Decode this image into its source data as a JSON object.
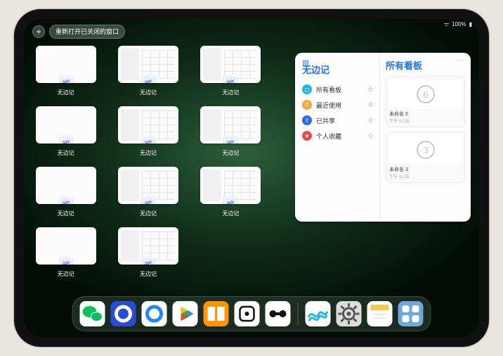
{
  "status": {
    "wifi": "᯾",
    "battery": "100%"
  },
  "top": {
    "add": "+",
    "reopen": "重新打开已关闭的窗口"
  },
  "thumb_label_default": "无边记",
  "thumb_count": 11,
  "thumb_variants": [
    "blank",
    "grid",
    "grid",
    "blank",
    "grid",
    "grid",
    "blank",
    "grid",
    "grid",
    "blank",
    "grid"
  ],
  "panel": {
    "title": "无边记",
    "right_title": "所有看板",
    "items": [
      {
        "icon_color": "#1eb6e6",
        "glyph": "◻",
        "label": "所有看板",
        "count": "0"
      },
      {
        "icon_color": "#f2a93b",
        "glyph": "⏱",
        "label": "最近使用",
        "count": "0"
      },
      {
        "icon_color": "#2f6fe4",
        "glyph": "⇪",
        "label": "已共享",
        "count": "0"
      },
      {
        "icon_color": "#e84d4d",
        "glyph": "♥",
        "label": "个人收藏",
        "count": "0"
      }
    ],
    "boards": [
      {
        "sketch": "6",
        "name": "未命名 6",
        "time": "下午 11:25"
      },
      {
        "sketch": "3",
        "name": "未命名 3",
        "time": "下午 11:25"
      }
    ]
  },
  "dock": [
    {
      "name": "wechat",
      "bg": "#ffffff",
      "fg": "#07c160",
      "glyph": "wechat"
    },
    {
      "name": "browser-1",
      "bg": "#2a4bd7",
      "fg": "#ffffff",
      "glyph": "ring"
    },
    {
      "name": "browser-2",
      "bg": "#ffffff",
      "fg": "#1e88ff",
      "glyph": "ring"
    },
    {
      "name": "play",
      "bg": "#ffffff",
      "fg": "#34a853",
      "glyph": "play"
    },
    {
      "name": "books",
      "bg": "#ff9500",
      "fg": "#ffffff",
      "glyph": "books"
    },
    {
      "name": "dice",
      "bg": "#ffffff",
      "fg": "#111111",
      "glyph": "die"
    },
    {
      "name": "connect",
      "bg": "#ffffff",
      "fg": "#111111",
      "glyph": "dumbbell"
    },
    {
      "name": "sep"
    },
    {
      "name": "freeform",
      "bg": "#ffffff",
      "fg": "#1eb6e6",
      "glyph": "scribble"
    },
    {
      "name": "settings",
      "bg": "#dcdcdc",
      "fg": "#555555",
      "glyph": "gear"
    },
    {
      "name": "notes",
      "bg": "#ffffff",
      "fg": "#f7c948",
      "glyph": "notes"
    },
    {
      "name": "app-library",
      "bg": "#6fa8dc",
      "fg": "#ffffff",
      "glyph": "grid4"
    }
  ]
}
